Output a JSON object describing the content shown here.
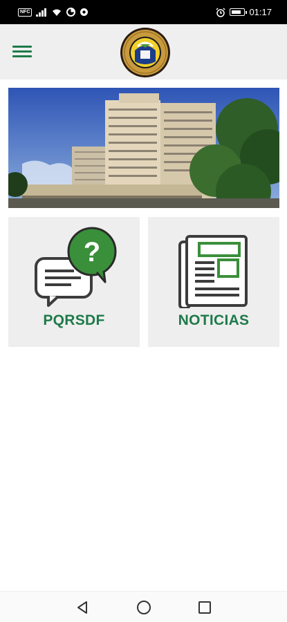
{
  "status_bar": {
    "badge": "NFC",
    "time": "01:17",
    "battery_level": 0.85
  },
  "app_bar": {
    "menu_icon": "hamburger-menu-icon",
    "logo": "institution-seal-logo"
  },
  "hero": {
    "image": "hospital-building-photo"
  },
  "cards": [
    {
      "label": "PQRSDF",
      "icon": "chat-question-icon"
    },
    {
      "label": "NOTICIAS",
      "icon": "newspaper-icon"
    }
  ],
  "nav_bar": {
    "back_icon": "back-triangle-icon",
    "home_icon": "home-circle-icon",
    "recents_icon": "recents-square-icon"
  },
  "colors": {
    "brand_green": "#1e7a4a",
    "icon_green": "#3a8f3a",
    "app_bar_bg": "#efefef",
    "card_bg": "#eeeeee",
    "status_bg": "#000000"
  }
}
